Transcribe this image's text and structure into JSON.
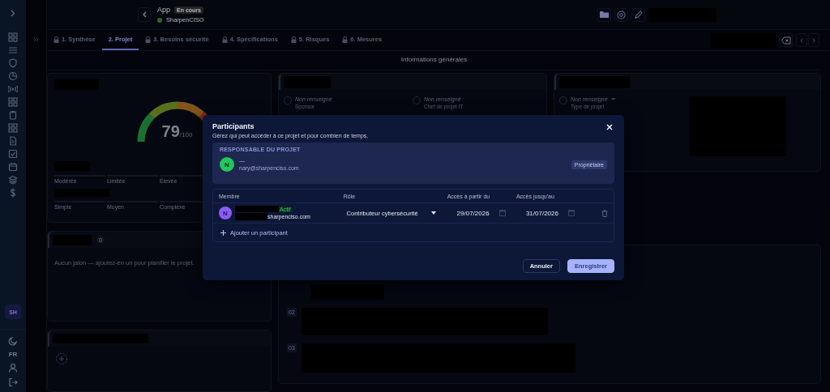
{
  "sidebar": {
    "items": [
      {
        "selected": false
      },
      {
        "selected": false
      },
      {
        "selected": false
      },
      {
        "selected": false
      },
      {
        "selected": false
      },
      {
        "selected": false
      },
      {
        "selected": false
      },
      {
        "selected": false
      },
      {
        "selected": false
      },
      {
        "selected": false
      },
      {
        "selected": false
      },
      {
        "selected": false
      },
      {
        "selected": false
      }
    ],
    "avatar": "SH",
    "language": "FR"
  },
  "header": {
    "title": "App",
    "status": "En cours",
    "organization": "SharpenCISO"
  },
  "tabs": [
    {
      "label": "1. Synthèse",
      "locked": true,
      "selected": false
    },
    {
      "label": "2. Projet",
      "locked": false,
      "selected": true
    },
    {
      "label": "3. Besoins sécurité",
      "locked": true,
      "selected": false
    },
    {
      "label": "4. Spécifications",
      "locked": true,
      "selected": false
    },
    {
      "label": "5. Risques",
      "locked": true,
      "selected": false
    },
    {
      "label": "6. Mesures",
      "locked": true,
      "selected": false
    }
  ],
  "section_title": "Informations générales",
  "score": {
    "value": "79",
    "max": "/100",
    "level": 0.79,
    "scale_1": [
      "Modérée",
      "Limitée",
      "Élevée"
    ],
    "scale_2": [
      "Simple",
      "Moyen",
      "Complexe"
    ]
  },
  "milestones": {
    "count": "0",
    "empty_text": "Aucun jalon — ajoutez-en un pour planifier le projet."
  },
  "people": [
    {
      "value": "Non renseigné",
      "label": "Sponsor"
    },
    {
      "value": "Non renseigné",
      "label": "Chef de projet IT"
    }
  ],
  "project_type": {
    "value": "Non renseigné",
    "label": "Type de projet"
  },
  "objectives": [
    {
      "number": "02"
    },
    {
      "number": "03"
    }
  ],
  "dialog": {
    "title": "Participants",
    "subtitle": "Gérez qui peut accéder à ce projet et pour combien de temps.",
    "owner_heading": "RESPONSABLE DU PROJET",
    "owner": {
      "initial": "N",
      "name": "—",
      "email": "nary@sharpenciso.com",
      "role": "Propriétaire",
      "color": "#22c55e"
    },
    "columns": [
      "Membre",
      "Rôle",
      "Accès à partir du",
      "Accès jusqu'au"
    ],
    "members": [
      {
        "initial": "N",
        "color": "#8b5cf6",
        "status": "Actif",
        "email": "sharpenciso.com",
        "role": "Contributeur cybersécurité",
        "from": "29/07/2026",
        "until": "31/07/2026"
      }
    ],
    "add_label": "Ajouter un participant",
    "buttons": [
      "Annuler",
      "Enregistrer"
    ]
  }
}
